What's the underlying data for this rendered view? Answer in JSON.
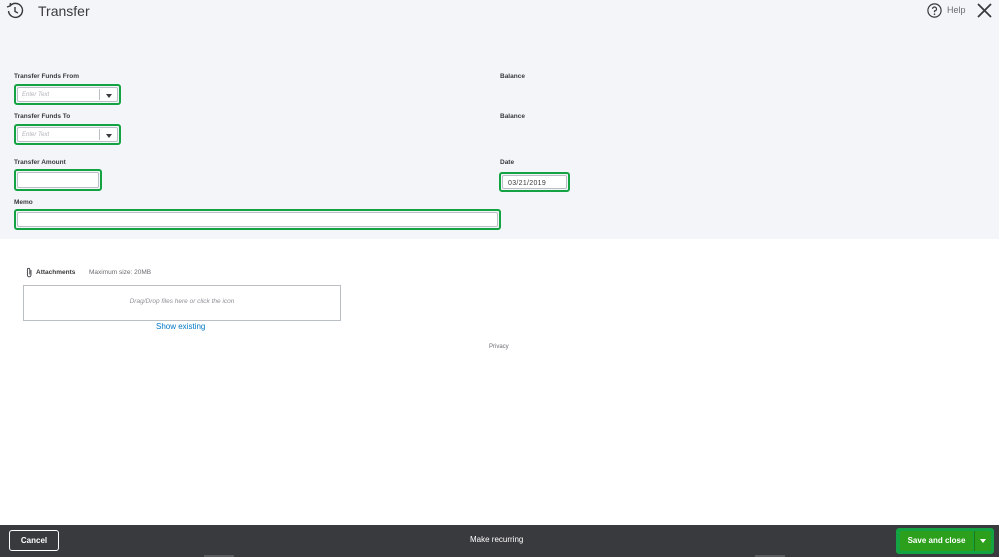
{
  "header": {
    "title": "Transfer",
    "help_label": "Help",
    "icons": {
      "history": "history-clock-icon",
      "help": "help-circle-icon",
      "close": "close-icon"
    }
  },
  "form": {
    "from": {
      "label": "Transfer Funds From",
      "placeholder": "Enter Text",
      "balance_label": "Balance"
    },
    "to": {
      "label": "Transfer Funds To",
      "placeholder": "Enter Text",
      "balance_label": "Balance"
    },
    "amount": {
      "label": "Transfer Amount",
      "value": ""
    },
    "date": {
      "label": "Date",
      "value": "03/21/2019"
    },
    "memo": {
      "label": "Memo",
      "value": ""
    }
  },
  "attachments": {
    "label": "Attachments",
    "max_size": "Maximum size: 20MB",
    "dropzone_text": "Drag/Drop files here or click the icon",
    "show_existing": "Show existing"
  },
  "privacy_label": "Privacy",
  "footer": {
    "cancel_label": "Cancel",
    "recurring_label": "Make recurring",
    "save_label": "Save and close"
  },
  "colors": {
    "highlight_green": "#13a342",
    "save_button": "#2ca01c",
    "footer_bg": "#393a3d",
    "link_blue": "#0077c5",
    "panel_bg": "#f4f5f8"
  }
}
